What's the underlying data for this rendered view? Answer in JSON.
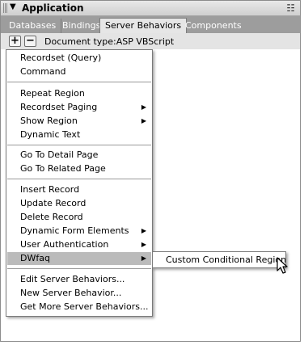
{
  "panel": {
    "title": "Application",
    "icons": {
      "collapse": "collapse-arrow-icon",
      "options": "panel-options-icon",
      "grip": "gripper-icon"
    }
  },
  "tabs": [
    "Databases",
    "Bindings",
    "Server Behaviors",
    "Components"
  ],
  "active_tab": "Server Behaviors",
  "toolbar": {
    "add_label": "+",
    "remove_label": "−",
    "doctype": "Document type:ASP VBScript"
  },
  "menu": {
    "group1": [
      "Recordset (Query)",
      "Command"
    ],
    "group2": [
      "Repeat Region",
      "Recordset Paging",
      "Show Region",
      "Dynamic Text"
    ],
    "group3": [
      "Go To Detail Page",
      "Go To Related Page"
    ],
    "group4": [
      "Insert Record",
      "Update Record",
      "Delete Record",
      "Dynamic Form Elements",
      "User Authentication",
      "DWfaq"
    ],
    "group5": [
      "Edit Server Behaviors...",
      "New Server Behavior...",
      "Get More Server Behaviors..."
    ],
    "highlighted": "DWfaq",
    "submenu_arrow_glyph": "▶"
  },
  "submenu": {
    "items": [
      "Custom Conditional Region"
    ]
  },
  "colors": {
    "tabbar": "#9d9d9d",
    "highlight": "#bbbbbb",
    "toolbar": "#e4e4e4"
  }
}
